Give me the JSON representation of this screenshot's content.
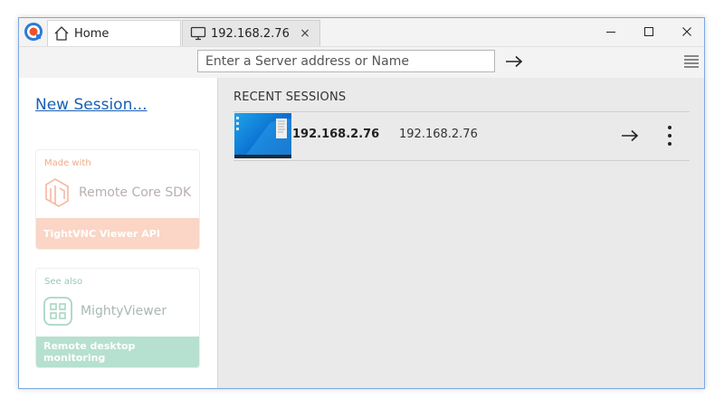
{
  "tabs": {
    "home": {
      "label": "Home",
      "icon": "home-icon"
    },
    "remote": {
      "label": "192.168.2.76",
      "icon": "monitor-icon",
      "close": "×"
    }
  },
  "window_controls": [
    "minimize-icon",
    "maximize-icon",
    "close-icon"
  ],
  "toolbar": {
    "server_placeholder": "Enter a Server address or Name",
    "server_value": "",
    "go_icon": "arrow-right-icon",
    "menu_icon": "hamburger-menu-icon"
  },
  "sidebar": {
    "new_session": "New Session...",
    "promos": [
      {
        "caption": "Made with",
        "brand": "Remote Core SDK",
        "footer": "TightVNC Viewer API",
        "icon": "remote-core-sdk-logo-icon",
        "accent": "#fbd5c5"
      },
      {
        "caption": "See also",
        "brand": "MightyViewer",
        "footer": "Remote desktop monitoring",
        "icon": "mightyviewer-logo-icon",
        "accent": "#b6e0cf"
      }
    ]
  },
  "main": {
    "section_title": "RECENT SESSIONS",
    "sessions": [
      {
        "name": "192.168.2.76",
        "address": "192.168.2.76",
        "thumbnail": "desktop-thumbnail"
      }
    ]
  },
  "colors": {
    "link": "#1a5fb4",
    "window_border": "#7aa7e0",
    "main_bg": "#eaeaea"
  }
}
